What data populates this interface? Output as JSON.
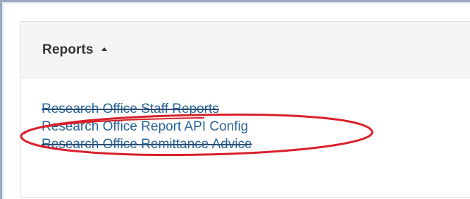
{
  "panel": {
    "title": "Reports",
    "caret_icon": "caret-up-icon",
    "links": [
      {
        "label": "Research Office Staff Reports",
        "struck": true
      },
      {
        "label": "Research Office Report API Config",
        "struck": false,
        "highlighted": true
      },
      {
        "label": "Research Office Remittance Advice",
        "struck": true
      }
    ]
  },
  "colors": {
    "link": "#2a6496",
    "heading_bg": "#f5f5f5",
    "annotation": "#d8202b"
  }
}
